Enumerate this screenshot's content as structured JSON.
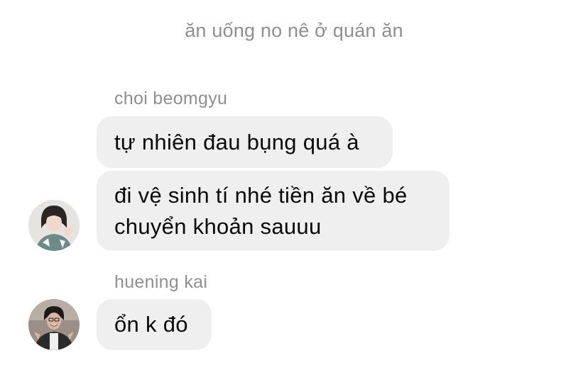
{
  "system_note": "ăn uống no nê ở quán ăn",
  "groups": [
    {
      "sender": "choi beomgyu",
      "avatar_icon": "person-avatar-icon",
      "messages": [
        "tự nhiên đau bụng quá à",
        "đi vệ sinh tí nhé tiền ăn về bé chuyển khoản sauuu"
      ]
    },
    {
      "sender": "huening kai",
      "avatar_icon": "person-avatar-icon",
      "messages": [
        "ổn k đó"
      ]
    }
  ],
  "colors": {
    "bubble_bg": "#efefef",
    "meta_text": "#8e8e93",
    "message_text": "#0a0a0a"
  }
}
